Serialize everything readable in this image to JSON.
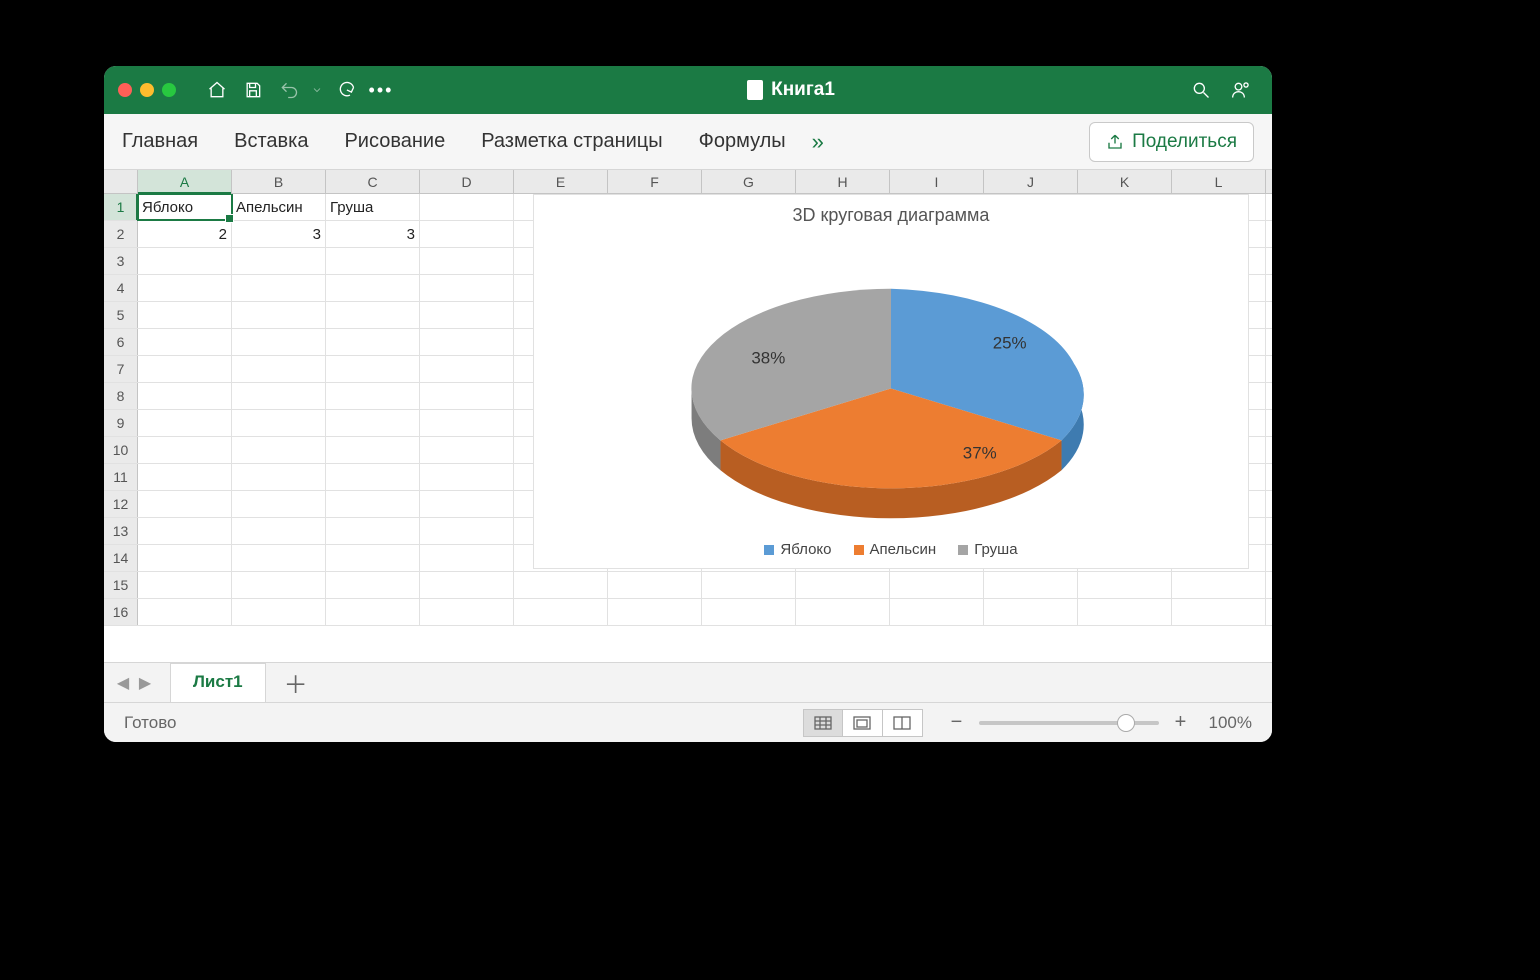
{
  "title": "Книга1",
  "ribbon": {
    "tabs": [
      "Главная",
      "Вставка",
      "Рисование",
      "Разметка страницы",
      "Формулы"
    ],
    "more": "»"
  },
  "share_label": "Поделиться",
  "cols": [
    "A",
    "B",
    "C",
    "D",
    "E",
    "F",
    "G",
    "H",
    "I",
    "J",
    "K",
    "L"
  ],
  "row_max": 16,
  "selected": {
    "row": 1,
    "col": "A"
  },
  "cells": {
    "r1": {
      "A": "Яблоко",
      "B": "Апельсин",
      "C": "Груша"
    },
    "r2": {
      "A": "2",
      "B": "3",
      "C": "3"
    }
  },
  "sheet_tab": "Лист1",
  "status": "Готово",
  "zoom": "100%",
  "chart_data": {
    "type": "pie",
    "title": "3D круговая диаграмма",
    "categories": [
      "Яблоко",
      "Апельсин",
      "Груша"
    ],
    "values": [
      2,
      3,
      3
    ],
    "labels": [
      "25%",
      "37%",
      "38%"
    ],
    "colors": [
      "#5b9bd5",
      "#ed7d31",
      "#a5a5a5"
    ]
  }
}
